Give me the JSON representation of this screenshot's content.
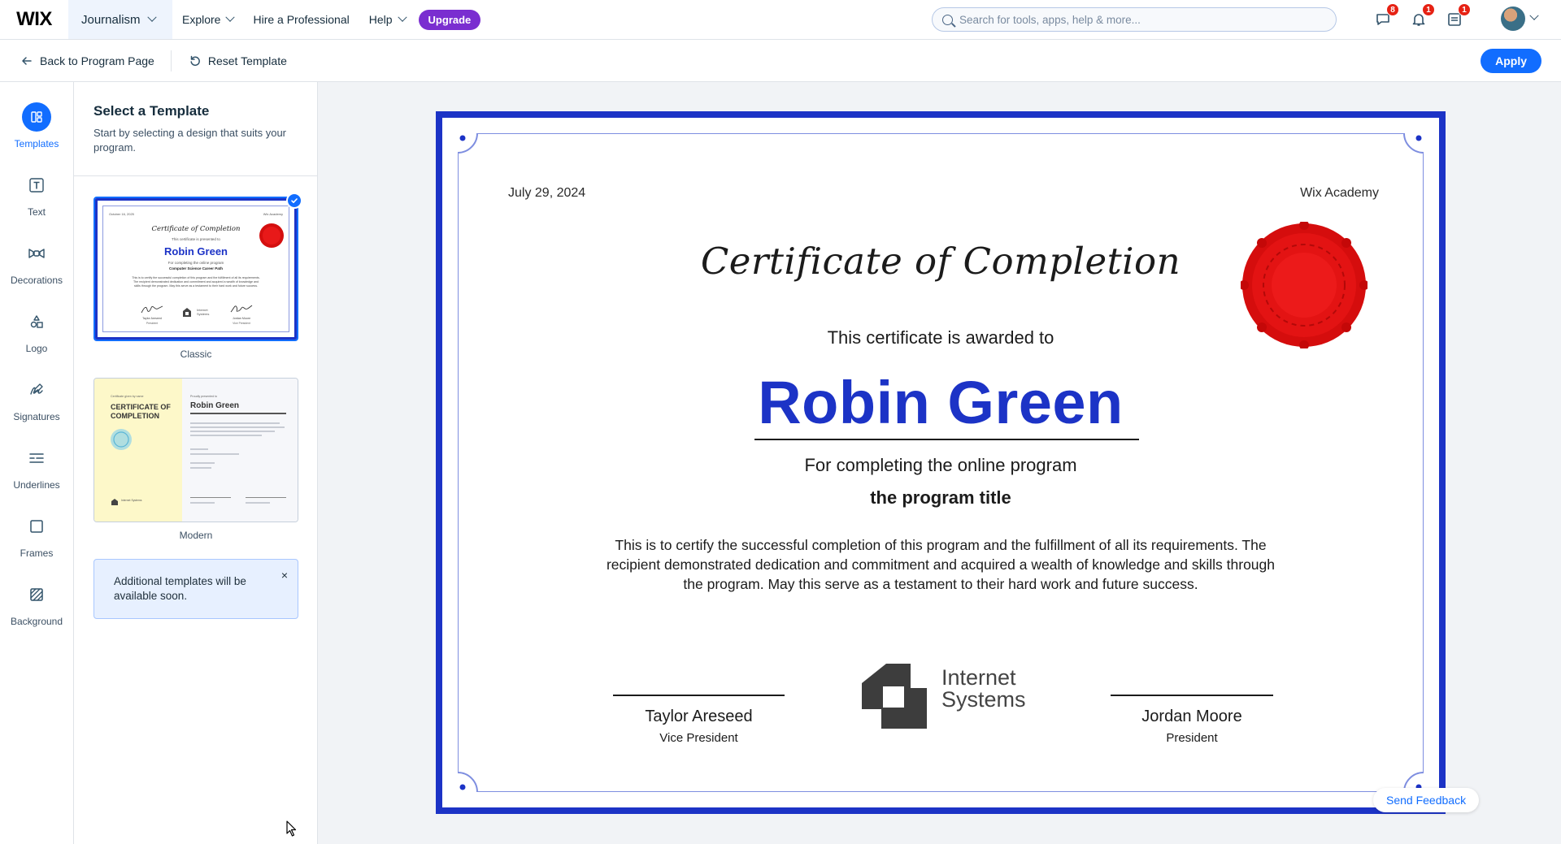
{
  "topbar": {
    "logo": "WIX",
    "site_name": "Journalism",
    "nav": [
      {
        "label": "Explore"
      },
      {
        "label": "Hire a Professional"
      },
      {
        "label": "Help"
      }
    ],
    "upgrade_label": "Upgrade",
    "search_placeholder": "Search for tools, apps, help & more...",
    "badges": {
      "messages": "8",
      "notifications": "1",
      "inbox": "1"
    }
  },
  "subbar": {
    "back_label": "Back to Program Page",
    "reset_label": "Reset Template",
    "apply_label": "Apply"
  },
  "rail": {
    "items": [
      {
        "label": "Templates",
        "icon": "templates-icon"
      },
      {
        "label": "Text",
        "icon": "text-icon"
      },
      {
        "label": "Decorations",
        "icon": "decorations-icon"
      },
      {
        "label": "Logo",
        "icon": "logo-icon"
      },
      {
        "label": "Signatures",
        "icon": "signatures-icon"
      },
      {
        "label": "Underlines",
        "icon": "underlines-icon"
      },
      {
        "label": "Frames",
        "icon": "frames-icon"
      },
      {
        "label": "Background",
        "icon": "background-icon"
      }
    ]
  },
  "panel": {
    "title": "Select a Template",
    "subtitle": "Start by selecting a design that suits your program.",
    "templates": [
      {
        "name": "Classic",
        "selected": true,
        "preview": {
          "date": "October 16, 2025",
          "org": "Wix Academy",
          "title": "Certificate of Completion",
          "awarded": "This certificate is presented to",
          "recipient": "Robin Green",
          "for": "For completing the online program",
          "program": "Computer Science Career Path",
          "body": "This is to certify the successful completion of this program and the fulfillment of all its requirements. The recipient demonstrated dedication and commitment and acquired a wealth of knowledge and skills through the program. May this serve as a testament to their hard work and future success.",
          "sig1_name": "Taylor Areseed",
          "sig1_role": "President",
          "sig2_name": "Jordan Moore",
          "sig2_role": "Vice President",
          "brand": "Internet Systems"
        }
      },
      {
        "name": "Modern",
        "selected": false,
        "preview": {
          "left_top": "Certificate given by name",
          "title": "CERTIFICATE OF COMPLETION",
          "right_top": "Proudly presented to",
          "recipient": "Robin Green",
          "brand": "Internet Systems"
        }
      }
    ],
    "notice": "Additional templates will be available soon.",
    "notice_close": "×"
  },
  "certificate": {
    "date": "July 29, 2024",
    "org": "Wix Academy",
    "title": "Certificate of Completion",
    "awarded": "This certificate is awarded to",
    "recipient": "Robin Green",
    "for_text": "For completing the online program",
    "program": "the program title",
    "body": "This is to certify the successful completion of this program and the fulfillment of all its requirements. The recipient demonstrated dedication and commitment and acquired a wealth of knowledge and skills through the program. May this serve as a testament to their hard work and future success.",
    "signatures": [
      {
        "name": "Taylor Areseed",
        "role": "Vice President"
      },
      {
        "name": "Jordan Moore",
        "role": "President"
      }
    ],
    "brand_line1": "Internet",
    "brand_line2": "Systems",
    "colors": {
      "frame": "#1c33c6",
      "seal": "#e01010",
      "name": "#1c33c6"
    }
  },
  "feedback_label": "Send Feedback",
  "colors": {
    "accent": "#116dff",
    "upgrade": "#7a2ed0",
    "badge": "#e62214"
  }
}
